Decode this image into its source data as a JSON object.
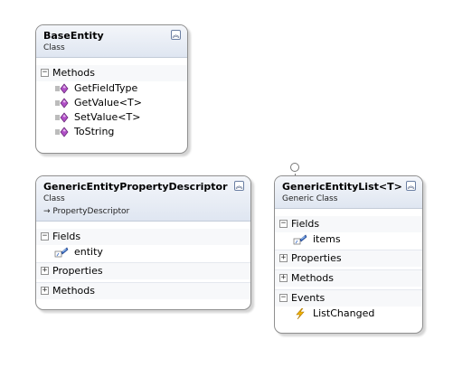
{
  "classes": {
    "base_entity": {
      "name": "BaseEntity",
      "kind": "Class",
      "sections": {
        "methods": {
          "label": "Methods",
          "toggle": "−",
          "members": [
            "GetFieldType",
            "GetValue<T>",
            "SetValue<T>",
            "ToString"
          ]
        }
      }
    },
    "property_descriptor": {
      "name": "GenericEntityPropertyDescriptor",
      "kind": "Class",
      "base_class": "→ PropertyDescriptor",
      "sections": {
        "fields": {
          "label": "Fields",
          "toggle": "−",
          "members": [
            "entity"
          ]
        },
        "properties": {
          "label": "Properties",
          "toggle": "+"
        },
        "methods": {
          "label": "Methods",
          "toggle": "+"
        }
      }
    },
    "entity_list": {
      "name": "GenericEntityList<T>",
      "kind": "Generic Class",
      "sections": {
        "fields": {
          "label": "Fields",
          "toggle": "−",
          "members": [
            "items"
          ]
        },
        "properties": {
          "label": "Properties",
          "toggle": "+"
        },
        "methods": {
          "label": "Methods",
          "toggle": "+"
        },
        "events": {
          "label": "Events",
          "toggle": "−",
          "members": [
            "ListChanged"
          ]
        }
      }
    }
  },
  "collapse_glyph": "︽",
  "colors": {
    "method_icon": "#b04fc6",
    "field_icon": "#3a6ec9",
    "event_icon": "#f2b500"
  }
}
